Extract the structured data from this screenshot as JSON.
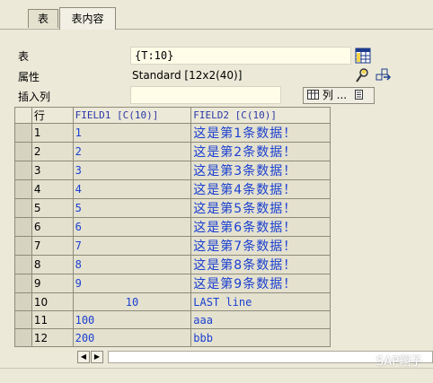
{
  "tabs": [
    {
      "label": "表"
    },
    {
      "label": "表内容"
    }
  ],
  "form": {
    "table_label": "表",
    "table_value": "{T:10}",
    "attr_label": "属性",
    "attr_value": "Standard [12x2(40)]",
    "insert_label": "插入列",
    "insert_value": "",
    "column_button": "列 ..."
  },
  "grid": {
    "headers": [
      "行",
      "FIELD1 [C(10)]",
      "FIELD2 [C(10)]"
    ],
    "rows": [
      {
        "n": "1",
        "f1": "1",
        "f2": "这是第1条数据！"
      },
      {
        "n": "2",
        "f1": "2",
        "f2": "这是第2条数据！"
      },
      {
        "n": "3",
        "f1": "3",
        "f2": "这是第3条数据！"
      },
      {
        "n": "4",
        "f1": "4",
        "f2": "这是第4条数据！"
      },
      {
        "n": "5",
        "f1": "5",
        "f2": "这是第5条数据！"
      },
      {
        "n": "6",
        "f1": "6",
        "f2": "这是第6条数据！"
      },
      {
        "n": "7",
        "f1": "7",
        "f2": "这是第7条数据！"
      },
      {
        "n": "8",
        "f1": "8",
        "f2": "这是第8条数据！"
      },
      {
        "n": "9",
        "f1": "9",
        "f2": "这是第9条数据！"
      },
      {
        "n": "10",
        "f1": "10",
        "f2": "LAST line"
      },
      {
        "n": "11",
        "f1": "100",
        "f2": "aaa"
      },
      {
        "n": "12",
        "f1": "200",
        "f2": "bbb"
      }
    ]
  },
  "watermark": "SAP翔子",
  "colors": {
    "background": "#ece9d8",
    "field_bg": "#fffde8",
    "cell_text": "#1a3fd0",
    "header_text": "#2a39a8"
  },
  "icons": [
    "table-icon",
    "where-used-icon",
    "navigate-icon",
    "column-icon",
    "document-icon",
    "scroll-left-icon",
    "scroll-right-icon"
  ]
}
